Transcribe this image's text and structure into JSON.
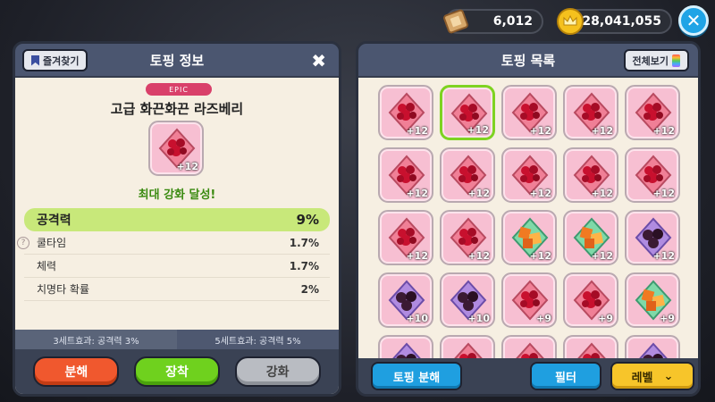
{
  "currency": {
    "tickets": "6,012",
    "coins": "28,041,055"
  },
  "left_panel": {
    "title": "토핑 정보",
    "favorite_label": "즐겨찾기",
    "rarity": "EPIC",
    "topping_name": "고급 화끈화끈 라즈베리",
    "topping_level": "+12",
    "status": "최대 강화 달성!",
    "stats": [
      {
        "name": "공격력",
        "value": "9%"
      },
      {
        "name": "쿨타임",
        "value": "1.7%"
      },
      {
        "name": "체력",
        "value": "1.7%"
      },
      {
        "name": "치명타 확률",
        "value": "2%"
      }
    ],
    "set_effects": [
      "3세트효과: 공격력 3%",
      "5세트효과: 공격력 5%"
    ],
    "buttons": {
      "disassemble": "분해",
      "equip": "장착",
      "enhance": "강화"
    }
  },
  "right_panel": {
    "title": "토핑 목록",
    "view_all_label": "전체보기",
    "items": [
      {
        "kind": "raspberry",
        "level": "+12"
      },
      {
        "kind": "raspberry",
        "level": "+12",
        "selected": true
      },
      {
        "kind": "raspberry",
        "level": "+12"
      },
      {
        "kind": "raspberry",
        "level": "+12"
      },
      {
        "kind": "raspberry",
        "level": "+12"
      },
      {
        "kind": "raspberry",
        "level": "+12"
      },
      {
        "kind": "raspberry",
        "level": "+12"
      },
      {
        "kind": "raspberry",
        "level": "+12"
      },
      {
        "kind": "raspberry",
        "level": "+12"
      },
      {
        "kind": "raspberry",
        "level": "+12"
      },
      {
        "kind": "raspberry",
        "level": "+12"
      },
      {
        "kind": "raspberry",
        "level": "+12"
      },
      {
        "kind": "caramel",
        "level": "+12"
      },
      {
        "kind": "caramel",
        "level": "+12"
      },
      {
        "kind": "chocolate",
        "level": "+12"
      },
      {
        "kind": "chocolate",
        "level": "+10"
      },
      {
        "kind": "chocolate",
        "level": "+10"
      },
      {
        "kind": "raspberry",
        "level": "+9"
      },
      {
        "kind": "raspberry",
        "level": "+9"
      },
      {
        "kind": "caramel",
        "level": "+9"
      },
      {
        "kind": "chocolate",
        "level": ""
      },
      {
        "kind": "raspberry",
        "level": ""
      },
      {
        "kind": "raspberry",
        "level": ""
      },
      {
        "kind": "raspberry",
        "level": ""
      },
      {
        "kind": "chocolate",
        "level": ""
      }
    ],
    "buttons": {
      "disassemble": "토핑 분해",
      "filter": "필터",
      "level": "레벨"
    }
  },
  "colors": {
    "raspberry": "#c8102e",
    "caramel": "#f07a22",
    "chocolate": "#3b1a33",
    "selected_border": "#7ed321"
  }
}
